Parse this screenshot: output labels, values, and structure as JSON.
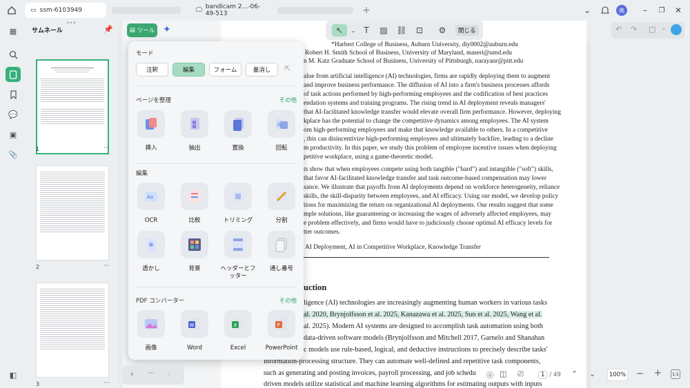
{
  "titlebar": {
    "tab1": "ssm-6103949",
    "tab2": "bandicam 2...-06-49-513",
    "avatar": "亮"
  },
  "sidebar": {
    "title": "サムネール",
    "pages": [
      "1",
      "2",
      "3"
    ]
  },
  "tool_panel": {
    "tool_button": "ツール",
    "mode_label": "モード",
    "modes": [
      "注釈",
      "編集",
      "フォーム",
      "墨消し"
    ],
    "organize_label": "ページを整理",
    "organize_more": "その他",
    "organize_tools": [
      "挿入",
      "抽出",
      "置換",
      "回転"
    ],
    "edit_label": "編集",
    "edit_tools": [
      "OCR",
      "比較",
      "トリミング",
      "分割",
      "透かし",
      "背景",
      "ヘッダーとフッター",
      "通し番号"
    ],
    "convert_label": "PDF コンバーター",
    "convert_more": "その他",
    "convert_tools": [
      "画像",
      "Word",
      "Excel",
      "PowerPoint"
    ]
  },
  "toolbar": {
    "close_label": "閉じる"
  },
  "document": {
    "affil1": "*Harbert College of Business, Auburn University, diy0002@auburn.edu",
    "affil2": "Robert H. Smith School of Business, University of Maryland, maseri@umd.edu",
    "affil3": "n M. Katz Graduate School of Business, University of Pittsburgh, narayanr@pitt.edu",
    "abs": [
      "alue from artificial intelligence (AI) technologies, firms are rapidly deploying them to augment",
      "and improve business performance. The diffusion of AI into a firm's business processes affords",
      "of task actions performed by high-performing employees and the codification of best practices",
      "endation systems and training programs. The rising trend in AI deployment reveals managers'",
      "that AI-facilitated knowledge transfer would elevate overall firm performance. However, deploying",
      "kplace has the potential to change the competitive dynamics among employees. The AI system",
      "om high-performing employees and make that knowledge available to others. In a competitive",
      ", this can disincentivize high-performing employees and ultimately backfire, leading to a decline",
      "m productivity. In this paper, we study this problem of employee incentive issues when deploying",
      "petitive workplace, using a game-theoretic model."
    ],
    "abs2": [
      "ts show that when employees compete using both tangible (\"hard\") and intangible (\"soft\") skills,",
      "that favor AI-facilitated knowledge transfer and task outcome-based compensation may lower",
      "sance. We illustrate that payoffs from AI deployments depend on workforce heterogeneity, reliance",
      "skills, the skill-disparity between employees, and AI efficacy. Using our model, we develop policy",
      "tions for maximizing the return on organizational AI deployments. Our results suggest that some",
      "mple solutions, like guaranteeing or increasing the wages of adversely affected employees, may",
      "e problem effectively, and firms would have to judiciously choose optimal AI efficacy levels for",
      "tter outcomes."
    ],
    "keywords": "AI Deployment, AI in Competitive Workplace, Knowledge Transfer",
    "heading": "uction",
    "body": [
      "ligence (AI) technologies are increasingly augmenting human workers in various tasks",
      "al. 2020, Brynjolfsson et al. 2025, Kanazawa et al. 2025, Sun et al. 2025, Wang et al.",
      "al. 2025). Modern AI systems are designed to accomplish task automation using both",
      "data-driven software models (Brynjolfsson and Mitchell 2017, Garnelo and Shanahan",
      "c models use rule-based, logical, and deductive instructions to precisely describe tasks'",
      "information-processing structure. They can automate well-defined and repetitive task components,",
      "such as generating and posting invoices, payroll processing, and job schedu",
      "driven models utilize statistical and machine learning algorithms for estimating outputs with inputs"
    ]
  },
  "pager": {
    "current": "1",
    "total": "/ 49",
    "zoom": "100%"
  },
  "nav": {
    "dots": "···"
  }
}
